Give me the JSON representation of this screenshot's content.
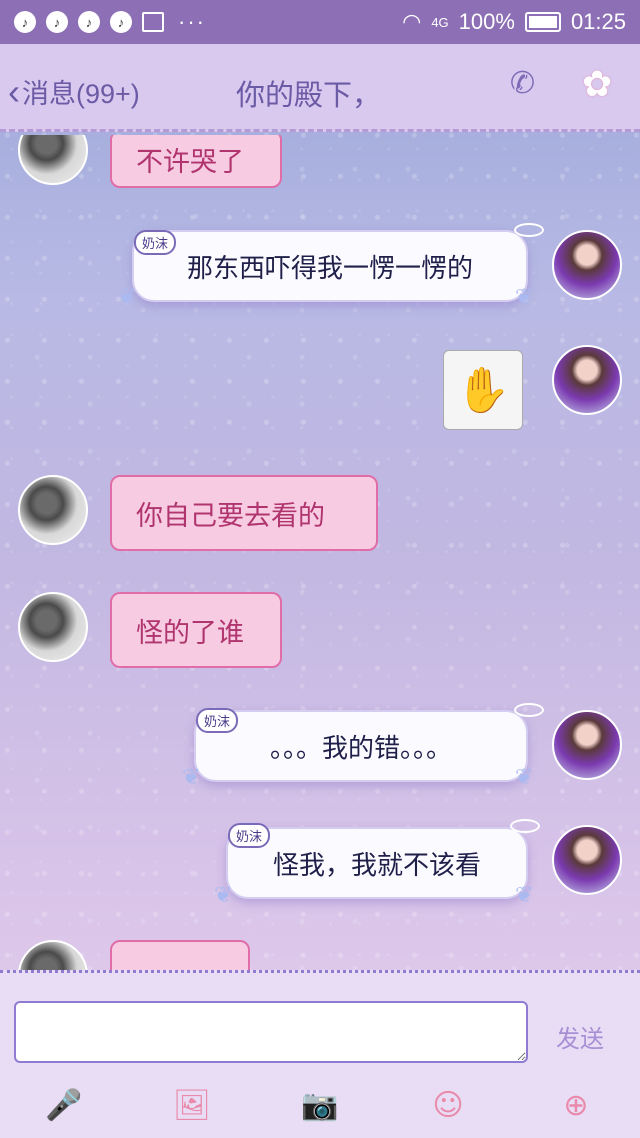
{
  "status_bar": {
    "network": "4G",
    "battery": "100%",
    "time": "01:25"
  },
  "header": {
    "back_label": "消息(99+)",
    "title": "你的殿下，"
  },
  "messages": [
    {
      "side": "left",
      "text": "不许哭了"
    },
    {
      "side": "right",
      "tag": "奶沫",
      "text": "那东西吓得我一愣一愣的"
    },
    {
      "side": "right",
      "type": "sticker"
    },
    {
      "side": "left",
      "text": "你自己要去看的"
    },
    {
      "side": "left",
      "text": "怪的了谁"
    },
    {
      "side": "right",
      "tag": "奶沫",
      "text": "。。。我的错。。。"
    },
    {
      "side": "right",
      "tag": "奶沫",
      "text": "怪我，我就不该看"
    }
  ],
  "input": {
    "value": "",
    "send_label": "发送"
  },
  "toolbar": {
    "icons": [
      "microphone-icon",
      "image-icon",
      "camera-icon",
      "emoji-icon",
      "plus-icon"
    ]
  },
  "colors": {
    "accent": "#6b5aa5",
    "pink_bubble": "#f7cce2",
    "pink_text": "#b0346e"
  }
}
